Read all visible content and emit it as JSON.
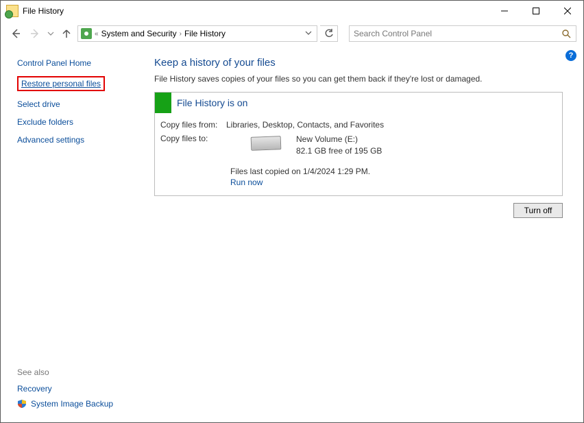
{
  "window": {
    "title": "File History"
  },
  "breadcrumbs": {
    "prefix": "«",
    "part1": "System and Security",
    "part2": "File History"
  },
  "search": {
    "placeholder": "Search Control Panel"
  },
  "sidebar": {
    "home": "Control Panel Home",
    "restore": "Restore personal files",
    "select_drive": "Select drive",
    "exclude": "Exclude folders",
    "advanced": "Advanced settings"
  },
  "see_also": {
    "header": "See also",
    "recovery": "Recovery",
    "backup": "System Image Backup"
  },
  "main": {
    "heading": "Keep a history of your files",
    "subtitle": "File History saves copies of your files so you can get them back if they're lost or damaged.",
    "status_title": "File History is on",
    "copy_from_label": "Copy files from:",
    "copy_from_value": "Libraries, Desktop, Contacts, and Favorites",
    "copy_to_label": "Copy files to:",
    "dest_name": "New Volume (E:)",
    "dest_space": "82.1 GB free of 195 GB",
    "last_copied": "Files last copied on 1/4/2024 1:29 PM.",
    "run_now": "Run now",
    "turn_off": "Turn off"
  },
  "help": {
    "glyph": "?"
  }
}
